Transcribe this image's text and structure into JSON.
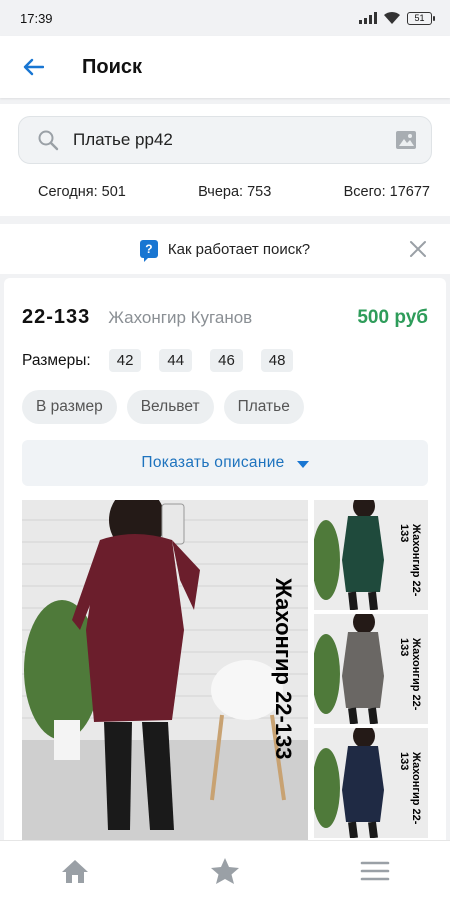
{
  "status_bar": {
    "time": "17:39",
    "battery": "51"
  },
  "header": {
    "title": "Поиск"
  },
  "search": {
    "value": "Платье рр42"
  },
  "stats": {
    "today": "Сегодня: 501",
    "yesterday": "Вчера: 753",
    "total": "Всего: 17677"
  },
  "help": {
    "text": "Как работает поиск?",
    "icon_glyph": "?"
  },
  "product": {
    "article": "22-133",
    "seller": "Жахонгир Куганов",
    "price": "500 руб",
    "sizes_label": "Размеры:",
    "sizes": [
      "42",
      "44",
      "46",
      "48"
    ],
    "tags": [
      "В размер",
      "Вельвет",
      "Платье"
    ],
    "show_description": "Показать описание",
    "photo_caption": "Жахонгир 22-133",
    "thumb_caption": "Жахонгир 22-133"
  },
  "colors": {
    "accent": "#1976d2",
    "price": "#2e9c5a",
    "dress_main": "#6b1e2c",
    "dress_green": "#1f4a3c",
    "dress_gray": "#6a6764",
    "dress_navy": "#1f2a44"
  },
  "icons": {
    "back": "arrow-left-icon",
    "search": "search-icon",
    "image": "image-icon",
    "help": "question-icon",
    "close": "close-icon",
    "dropdown": "caret-down-icon",
    "nav": [
      "home-icon",
      "star-icon",
      "menu-icon"
    ]
  }
}
